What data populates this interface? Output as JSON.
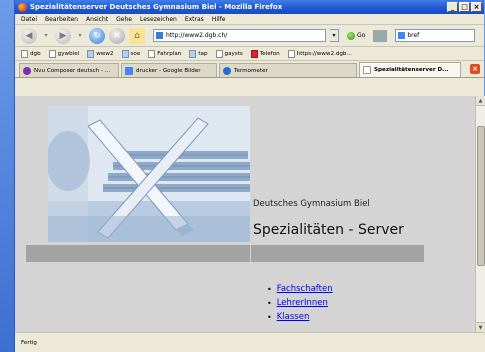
{
  "window": {
    "title": "Spezialitätenserver Deutsches Gymnasium Biel - Mozilla Firefox",
    "buttons": [
      "_",
      "□",
      "×"
    ]
  },
  "menu": [
    "Datei",
    "Bearbeiten",
    "Ansicht",
    "Gehe",
    "Lesezeichen",
    "Extras",
    "Hilfe"
  ],
  "nav": {
    "url": "http://www2.dgb.ch/",
    "go_label": "Go",
    "search_value": "bref"
  },
  "bookmarks": [
    "dgb",
    "gywbiel",
    "www2",
    "soe",
    "Fahrplan",
    "tap",
    "gaysts",
    "Telefon",
    "https://www2.dgb..."
  ],
  "tabs": [
    {
      "label": "Nvu Composer deutsch - ...",
      "color": "#7a2fb0",
      "active": false
    },
    {
      "label": "drucker - Google Bilder",
      "color": "#4285f4",
      "active": false
    },
    {
      "label": "Termometer",
      "color": "#2a6bd1",
      "active": false
    },
    {
      "label": "Spezialitätenserver D...",
      "color": "#ffffff",
      "active": true
    }
  ],
  "page": {
    "school": "Deutsches Gymnasium Biel",
    "heading": "Spezialitäten - Server",
    "links": [
      "Fachschaften",
      "LehrerInnen",
      "Klassen"
    ]
  },
  "status": "Fertig",
  "colors": {
    "titlebar": "#1f56d1",
    "page_bg": "#d4d4d4",
    "band": "#a3a3a3",
    "link": "#0000ee"
  }
}
